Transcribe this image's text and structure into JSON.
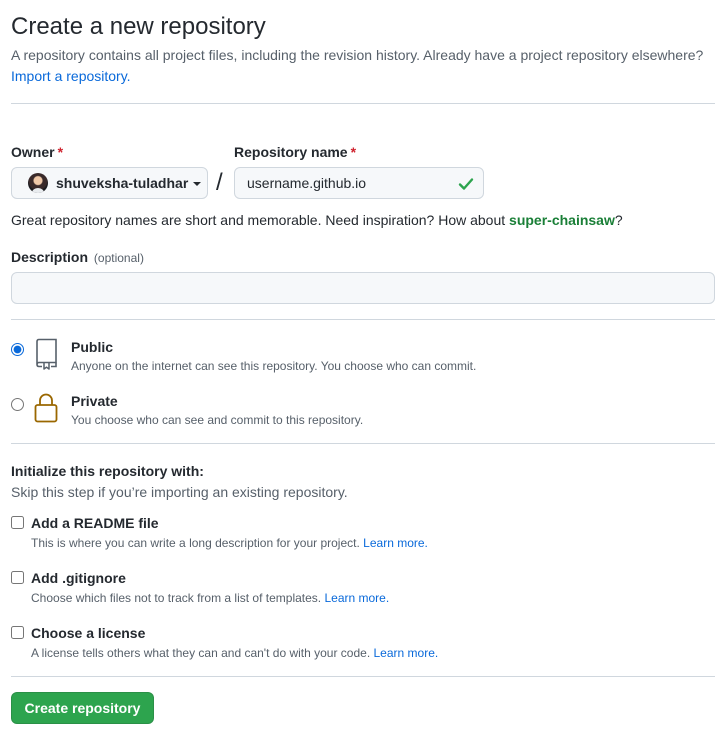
{
  "header": {
    "title": "Create a new repository",
    "intro_text": "A repository contains all project files, including the revision history. Already have a project repository elsewhere?",
    "import_link": "Import a repository."
  },
  "owner": {
    "label": "Owner",
    "required_mark": "*",
    "selected": "shuveksha-tuladhar"
  },
  "repo_name": {
    "label": "Repository name",
    "required_mark": "*",
    "value": "username.github.io",
    "separator": "/"
  },
  "hint": {
    "text": "Great repository names are short and memorable. Need inspiration? How about ",
    "suggestion": "super-chainsaw",
    "end": "?"
  },
  "description": {
    "label": "Description",
    "optional": "(optional)",
    "value": ""
  },
  "visibility": {
    "selected": "public",
    "options": [
      {
        "id": "public",
        "title": "Public",
        "desc": "Anyone on the internet can see this repository. You choose who can commit.",
        "icon": "repo-icon"
      },
      {
        "id": "private",
        "title": "Private",
        "desc": "You choose who can see and commit to this repository.",
        "icon": "lock-icon"
      }
    ]
  },
  "init": {
    "title": "Initialize this repository with:",
    "note": "Skip this step if you’re importing an existing repository.",
    "options": [
      {
        "title": "Add a README file",
        "desc": "This is where you can write a long description for your project.",
        "link": "Learn more."
      },
      {
        "title": "Add .gitignore",
        "desc": "Choose which files not to track from a list of templates.",
        "link": "Learn more."
      },
      {
        "title": "Choose a license",
        "desc": "A license tells others what they can and can't do with your code.",
        "link": "Learn more."
      }
    ]
  },
  "submit": {
    "label": "Create repository"
  },
  "colors": {
    "accent": "#0969da",
    "success": "#2da44e",
    "suggestion": "#1a7f37",
    "lock": "#9a6700"
  }
}
